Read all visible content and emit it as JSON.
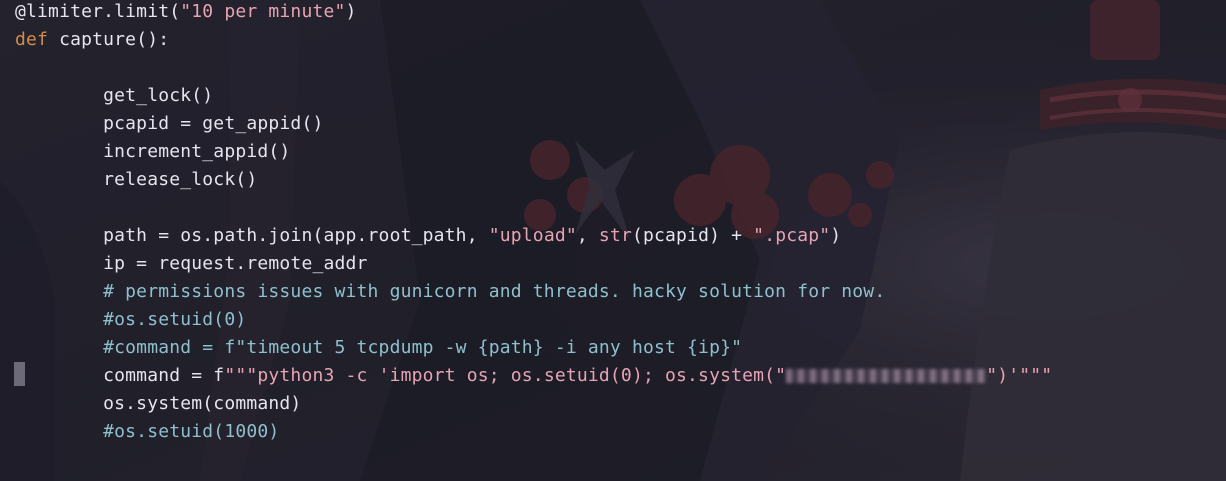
{
  "code": {
    "lines": [
      {
        "id": "l1",
        "parts": [
          {
            "t": "decorator",
            "s": "@limiter.limit("
          },
          {
            "t": "string",
            "s": "\"10 per minute\""
          },
          {
            "t": "plain",
            "s": ")"
          }
        ]
      },
      {
        "id": "l2",
        "parts": [
          {
            "t": "keyword",
            "s": "def "
          },
          {
            "t": "plain",
            "s": "capture():"
          }
        ]
      },
      {
        "id": "l3",
        "parts": []
      },
      {
        "id": "l4",
        "parts": [
          {
            "t": "plain",
            "s": "        get_lock()"
          }
        ]
      },
      {
        "id": "l5",
        "parts": [
          {
            "t": "plain",
            "s": "        pcapid = get_appid()"
          }
        ]
      },
      {
        "id": "l6",
        "parts": [
          {
            "t": "plain",
            "s": "        increment_appid()"
          }
        ]
      },
      {
        "id": "l7",
        "parts": [
          {
            "t": "plain",
            "s": "        release_lock()"
          }
        ]
      },
      {
        "id": "l8",
        "parts": []
      },
      {
        "id": "l9",
        "parts": [
          {
            "t": "plain",
            "s": "        path = os.path.join(app.root_path, "
          },
          {
            "t": "string",
            "s": "\"upload\""
          },
          {
            "t": "plain",
            "s": ", "
          },
          {
            "t": "builtin",
            "s": "str"
          },
          {
            "t": "plain",
            "s": "(pcapid) + "
          },
          {
            "t": "string",
            "s": "\".pcap\""
          },
          {
            "t": "plain",
            "s": ")"
          }
        ]
      },
      {
        "id": "l10",
        "parts": [
          {
            "t": "plain",
            "s": "        ip = request.remote_addr"
          }
        ]
      },
      {
        "id": "l11",
        "parts": [
          {
            "t": "comment",
            "s": "        # permissions issues with gunicorn and threads. hacky solution for now."
          }
        ]
      },
      {
        "id": "l12",
        "parts": [
          {
            "t": "comment",
            "s": "        #os.setuid(0)"
          }
        ]
      },
      {
        "id": "l13",
        "parts": [
          {
            "t": "comment",
            "s": "        #command = f\"timeout 5 tcpdump -w {path} -i any host {ip}\""
          }
        ]
      },
      {
        "id": "l14",
        "parts": [
          {
            "t": "plain",
            "s": "        command = f"
          },
          {
            "t": "string",
            "s": "\"\"\"python3 -c 'import os; os.setuid(0); os.system(\""
          },
          {
            "t": "redacted",
            "s": ""
          },
          {
            "t": "string",
            "s": "\")'\"\"\""
          }
        ]
      },
      {
        "id": "l15",
        "parts": [
          {
            "t": "plain",
            "s": "        os.system(command)"
          }
        ]
      },
      {
        "id": "l16",
        "parts": [
          {
            "t": "comment",
            "s": "        #os.setuid(1000)"
          }
        ]
      }
    ]
  },
  "colors": {
    "keyword": "#cf8e4a",
    "string": "#e6a3b3",
    "comment": "#8ec0cc",
    "plain": "#e6e4ee"
  }
}
